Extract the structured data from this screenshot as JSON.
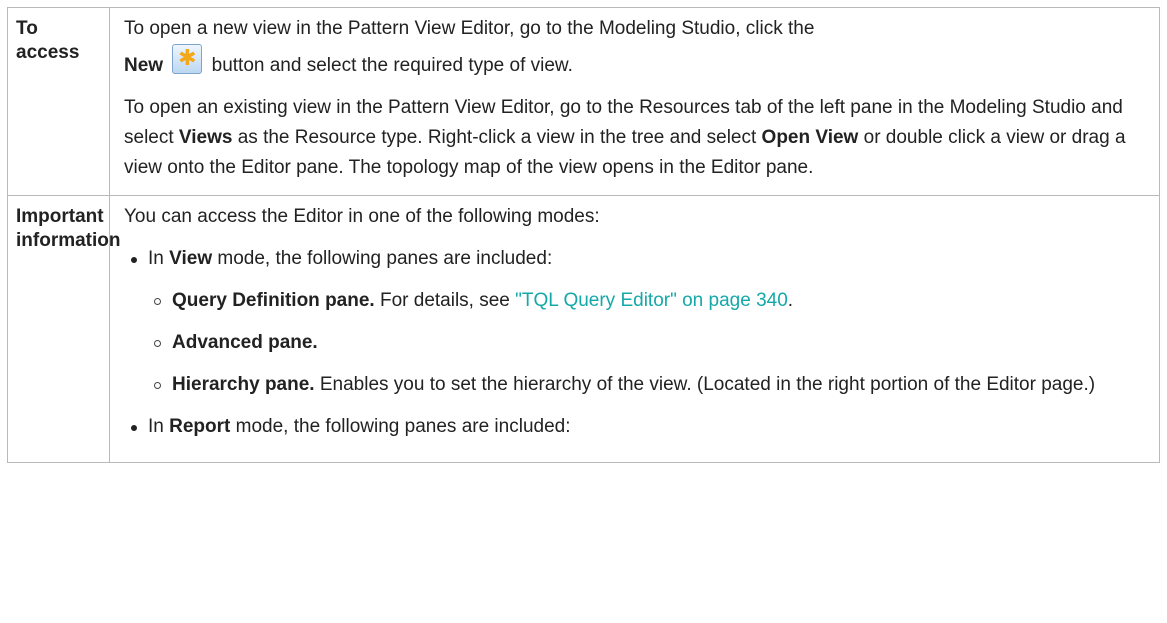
{
  "rows": {
    "access": {
      "label": "To access",
      "p1": {
        "before_new": "To open a new view in the Pattern View Editor, go to the Modeling Studio, click the",
        "new_bold": "New",
        "after_icon": "button and select the required type of view."
      },
      "p2": {
        "t1": "To open an existing view in the Pattern View Editor, go to the Resources tab of the left pane in the Modeling Studio and select",
        "b1": "Views",
        "t2": "as the Resource type. Right-click a view in the tree and select",
        "b2": "Open View",
        "t3": "or double click a view or drag a view onto the Editor pane. The topology map of the view opens in the Editor pane."
      }
    },
    "important": {
      "label": "Important information",
      "intro": "You can access the Editor in one of the following modes:",
      "view_mode": {
        "prefix": "In",
        "bold": "View",
        "suffix": "mode, the following panes are included:",
        "items": {
          "query": {
            "bold": "Query Definition pane.",
            "text": "For details, see",
            "link": "\"TQL Query Editor\" on page 340",
            "end": "."
          },
          "advanced": {
            "bold": "Advanced pane."
          },
          "hierarchy": {
            "bold": "Hierarchy pane.",
            "text": "Enables you to set the hierarchy of the view. (Located in the right portion of the Editor page.)"
          }
        }
      },
      "report_mode": {
        "prefix": "In",
        "bold": "Report",
        "suffix": "mode, the following panes are included:"
      }
    }
  },
  "icons": {
    "new_button": "new-view-star-icon"
  },
  "colors": {
    "link": "#15a8a8",
    "border": "#b9b9b9",
    "text": "#222222"
  }
}
